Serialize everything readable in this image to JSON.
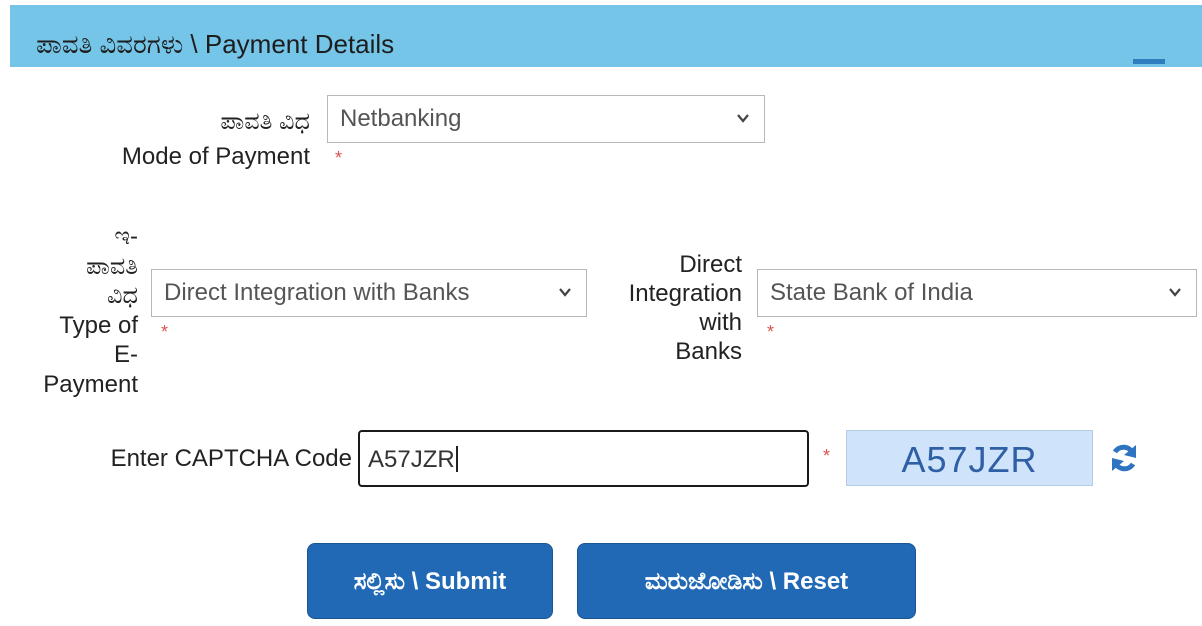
{
  "header": {
    "title": "ಪಾವತಿ ವಿವರಗಳು \\ Payment Details"
  },
  "mode_of_payment": {
    "label_kn": "ಪಾವತಿ ವಿಧ",
    "label_en": "Mode of Payment",
    "value": "Netbanking",
    "required_mark": "*"
  },
  "type_of_epayment": {
    "label_lines": [
      "ಇ-",
      "ಪಾವತಿ",
      "ವಿಧ",
      "Type of",
      "E-",
      "Payment"
    ],
    "value": "Direct Integration with Banks",
    "required_mark": "*"
  },
  "direct_integration": {
    "label_lines": [
      "Direct",
      "Integration",
      "with",
      "Banks"
    ],
    "value": "State Bank of India",
    "required_mark": "*"
  },
  "captcha": {
    "label": "Enter CAPTCHA Code",
    "input_value": "A57JZR",
    "required_mark": "*",
    "code": "A57JZR"
  },
  "buttons": {
    "submit": "ಸಲ್ಲಿಸು \\ Submit",
    "reset": "ಮರುಜೋಡಿಸು \\ Reset"
  },
  "colors": {
    "header_bg": "#75c5e9",
    "button_bg": "#2169b5",
    "captcha_bg": "#cfe3fb",
    "required": "#d9534f"
  }
}
